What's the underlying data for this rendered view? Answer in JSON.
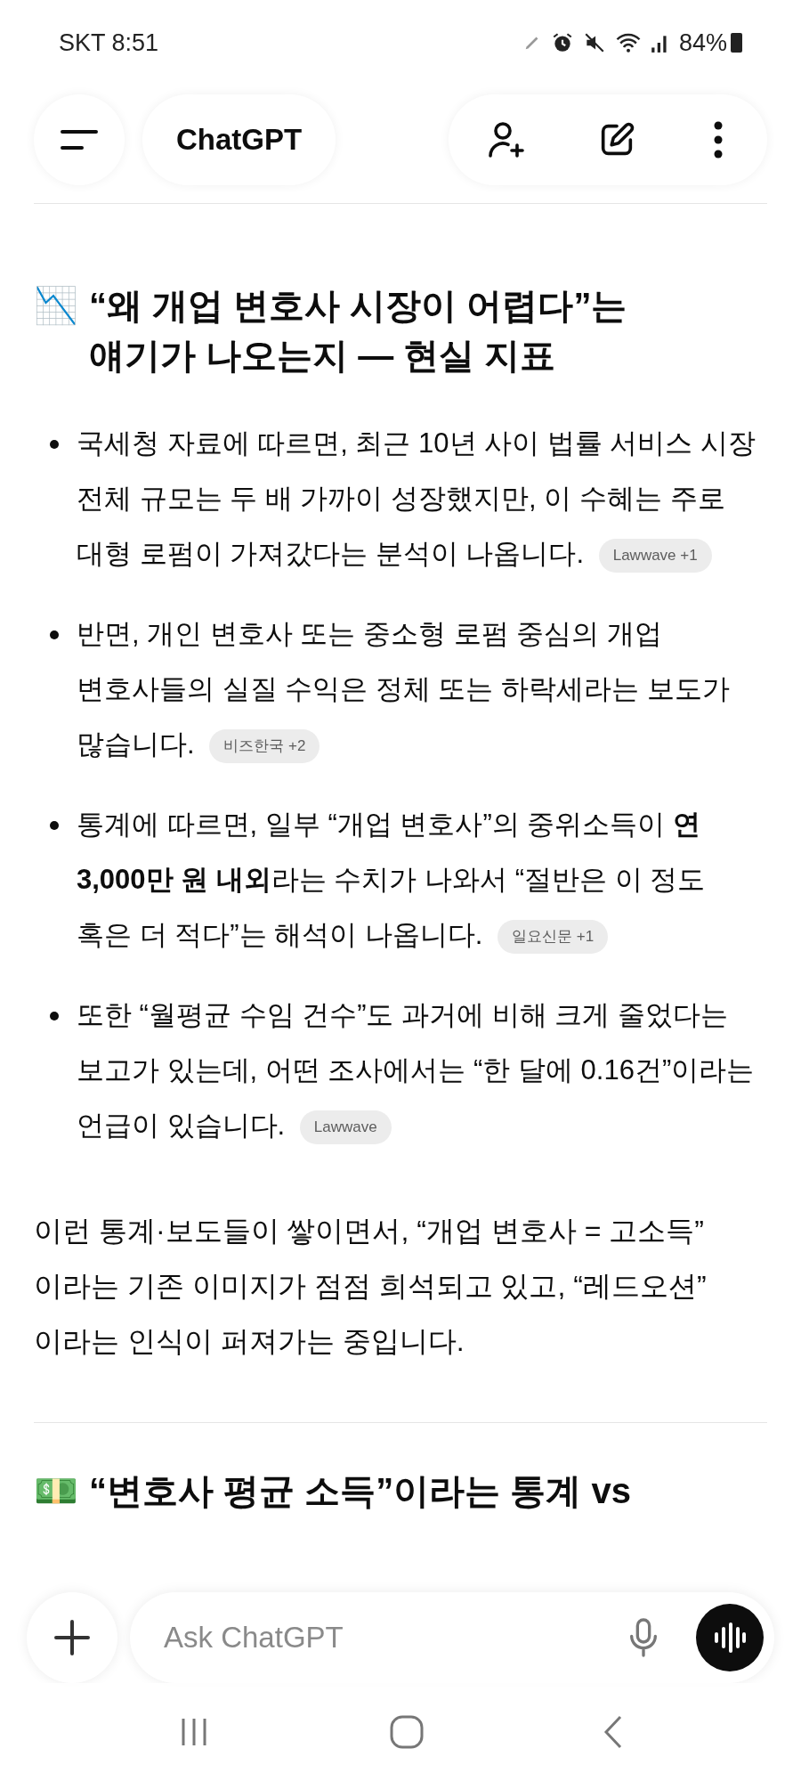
{
  "status_bar": {
    "carrier_time": "SKT 8:51",
    "battery": "84%"
  },
  "header": {
    "title": "ChatGPT"
  },
  "section_1": {
    "icon": "📉",
    "heading": "“왜 개업 변호사 시장이 어렵다”는 얘기가 나오는지 — 현실 지표",
    "bullets": [
      {
        "text": "국세청 자료에 따르면, 최근 10년 사이 법률 서비스 시장 전체 규모는 두 배 가까이 성장했지만, 이 수혜는 주로 대형 로펌이 가져갔다는 분석이 나옵니다.",
        "source": "Lawwave +1"
      },
      {
        "text": "반면, 개인 변호사 또는 중소형 로펌 중심의 개업 변호사들의 실질 수익은 정체 또는 하락세라는 보도가 많습니다.",
        "source": "비즈한국 +2"
      },
      {
        "text": "통계에 따르면, 일부 “개업 변호사”의 중위소득이 **연 3,000만 원 내외**라는 수치가 나와서 “절반은 이 정도 혹은 더 적다”는 해석이 나옵니다.",
        "source": "일요신문 +1"
      },
      {
        "text": "또한 “월평균 수임 건수”도  과거에 비해 크게 줄었다는 보고가 있는데, 어떤 조사에서는 “한 달에 0.16건”이라는 언급이 있습니다.",
        "source": "Lawwave"
      }
    ],
    "paragraph": "이런 통계·보도들이 쌓이면서, “개업 변호사 = 고소득” 이라는 기존 이미지가 점점 희석되고 있고, “레드오션” 이라는 인식이 퍼져가는 중입니다."
  },
  "section_2": {
    "icon": "💵",
    "heading": "“변호사 평균 소득”이라는 통계 vs"
  },
  "composer": {
    "placeholder": "Ask ChatGPT"
  }
}
